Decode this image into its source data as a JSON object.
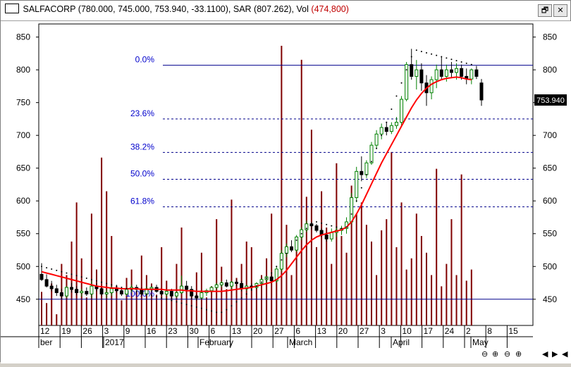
{
  "title": {
    "symbol": "SALFACORP",
    "ohlc": "(780.000, 745.000, 753.940, -33.1100),",
    "sar": "SAR (807.262),",
    "vol_label": "Vol",
    "vol_value": "(474,800)"
  },
  "window_buttons": {
    "restore": "🗗",
    "close": "✕"
  },
  "nav_buttons": [
    "⊖",
    "⊕",
    "⊖",
    "⊕",
    "◀",
    "▶",
    "◀",
    "▶"
  ],
  "colors": {
    "up": "#008000",
    "down": "#000000",
    "ma": "#ff0000",
    "volume": "#800000",
    "fib": "#00008b",
    "sar": "#000000",
    "last_price_bg": "#000000"
  },
  "chart_data": {
    "type": "candlestick",
    "ylim": [
      410,
      870
    ],
    "y_ticks": [
      450,
      500,
      550,
      600,
      650,
      700,
      750,
      800,
      850
    ],
    "last_price_label": "753.940",
    "x_tick_labels": [
      "12",
      "19",
      "26",
      "3",
      "9",
      "16",
      "23",
      "30",
      "6",
      "13",
      "20",
      "27",
      "6",
      "13",
      "20",
      "27",
      "3",
      "10",
      "17",
      "24",
      "2",
      "8",
      "15"
    ],
    "month_labels": [
      "ber",
      "2017",
      "February",
      "March",
      "April",
      "May"
    ],
    "fib_levels": [
      {
        "label": "0.0%",
        "price": 807
      },
      {
        "label": "23.6%",
        "price": 725
      },
      {
        "label": "38.2%",
        "price": 674
      },
      {
        "label": "50.0%",
        "price": 633
      },
      {
        "label": "61.8%",
        "price": 591
      },
      {
        "label": "100.0%",
        "price": 450
      }
    ],
    "candles": [
      {
        "o": 488,
        "h": 505,
        "l": 478,
        "c": 480
      },
      {
        "o": 480,
        "h": 488,
        "l": 468,
        "c": 470
      },
      {
        "o": 470,
        "h": 478,
        "l": 462,
        "c": 466
      },
      {
        "o": 466,
        "h": 472,
        "l": 455,
        "c": 460
      },
      {
        "o": 460,
        "h": 466,
        "l": 450,
        "c": 455
      },
      {
        "o": 455,
        "h": 470,
        "l": 452,
        "c": 468
      },
      {
        "o": 468,
        "h": 475,
        "l": 460,
        "c": 465
      },
      {
        "o": 465,
        "h": 470,
        "l": 456,
        "c": 460
      },
      {
        "o": 460,
        "h": 466,
        "l": 454,
        "c": 462
      },
      {
        "o": 462,
        "h": 468,
        "l": 455,
        "c": 458
      },
      {
        "o": 458,
        "h": 478,
        "l": 452,
        "c": 470
      },
      {
        "o": 470,
        "h": 475,
        "l": 462,
        "c": 466
      },
      {
        "o": 466,
        "h": 470,
        "l": 455,
        "c": 458
      },
      {
        "o": 458,
        "h": 465,
        "l": 452,
        "c": 460
      },
      {
        "o": 460,
        "h": 470,
        "l": 455,
        "c": 466
      },
      {
        "o": 466,
        "h": 472,
        "l": 460,
        "c": 463
      },
      {
        "o": 463,
        "h": 468,
        "l": 455,
        "c": 458
      },
      {
        "o": 458,
        "h": 468,
        "l": 455,
        "c": 465
      },
      {
        "o": 465,
        "h": 472,
        "l": 460,
        "c": 468
      },
      {
        "o": 468,
        "h": 472,
        "l": 460,
        "c": 465
      },
      {
        "o": 465,
        "h": 468,
        "l": 455,
        "c": 458
      },
      {
        "o": 458,
        "h": 470,
        "l": 455,
        "c": 466
      },
      {
        "o": 466,
        "h": 470,
        "l": 462,
        "c": 468
      },
      {
        "o": 468,
        "h": 472,
        "l": 460,
        "c": 462
      },
      {
        "o": 462,
        "h": 465,
        "l": 455,
        "c": 458
      },
      {
        "o": 458,
        "h": 465,
        "l": 454,
        "c": 462
      },
      {
        "o": 462,
        "h": 466,
        "l": 450,
        "c": 455
      },
      {
        "o": 455,
        "h": 462,
        "l": 452,
        "c": 460
      },
      {
        "o": 460,
        "h": 486,
        "l": 458,
        "c": 470
      },
      {
        "o": 470,
        "h": 478,
        "l": 462,
        "c": 465
      },
      {
        "o": 465,
        "h": 470,
        "l": 450,
        "c": 455
      },
      {
        "o": 455,
        "h": 458,
        "l": 448,
        "c": 452
      },
      {
        "o": 452,
        "h": 462,
        "l": 450,
        "c": 460
      },
      {
        "o": 460,
        "h": 466,
        "l": 455,
        "c": 463
      },
      {
        "o": 463,
        "h": 470,
        "l": 460,
        "c": 468
      },
      {
        "o": 468,
        "h": 475,
        "l": 465,
        "c": 472
      },
      {
        "o": 472,
        "h": 478,
        "l": 468,
        "c": 475
      },
      {
        "o": 475,
        "h": 480,
        "l": 468,
        "c": 470
      },
      {
        "o": 470,
        "h": 478,
        "l": 464,
        "c": 476
      },
      {
        "o": 476,
        "h": 480,
        "l": 470,
        "c": 474
      },
      {
        "o": 474,
        "h": 478,
        "l": 462,
        "c": 466
      },
      {
        "o": 466,
        "h": 472,
        "l": 463,
        "c": 470
      },
      {
        "o": 470,
        "h": 474,
        "l": 464,
        "c": 468
      },
      {
        "o": 468,
        "h": 476,
        "l": 466,
        "c": 474
      },
      {
        "o": 474,
        "h": 482,
        "l": 470,
        "c": 480
      },
      {
        "o": 480,
        "h": 486,
        "l": 475,
        "c": 484
      },
      {
        "o": 484,
        "h": 488,
        "l": 476,
        "c": 478
      },
      {
        "o": 478,
        "h": 500,
        "l": 475,
        "c": 496
      },
      {
        "o": 496,
        "h": 525,
        "l": 492,
        "c": 520
      },
      {
        "o": 520,
        "h": 535,
        "l": 514,
        "c": 530
      },
      {
        "o": 530,
        "h": 540,
        "l": 522,
        "c": 525
      },
      {
        "o": 525,
        "h": 548,
        "l": 522,
        "c": 545
      },
      {
        "o": 545,
        "h": 560,
        "l": 540,
        "c": 556
      },
      {
        "o": 556,
        "h": 570,
        "l": 552,
        "c": 565
      },
      {
        "o": 565,
        "h": 568,
        "l": 556,
        "c": 562
      },
      {
        "o": 562,
        "h": 565,
        "l": 552,
        "c": 555
      },
      {
        "o": 555,
        "h": 558,
        "l": 545,
        "c": 548
      },
      {
        "o": 548,
        "h": 552,
        "l": 538,
        "c": 542
      },
      {
        "o": 542,
        "h": 558,
        "l": 538,
        "c": 552
      },
      {
        "o": 552,
        "h": 560,
        "l": 545,
        "c": 555
      },
      {
        "o": 555,
        "h": 562,
        "l": 548,
        "c": 558
      },
      {
        "o": 558,
        "h": 575,
        "l": 550,
        "c": 568
      },
      {
        "o": 568,
        "h": 612,
        "l": 565,
        "c": 605
      },
      {
        "o": 605,
        "h": 652,
        "l": 598,
        "c": 645
      },
      {
        "o": 645,
        "h": 668,
        "l": 630,
        "c": 640
      },
      {
        "o": 640,
        "h": 662,
        "l": 635,
        "c": 658
      },
      {
        "o": 658,
        "h": 690,
        "l": 655,
        "c": 685
      },
      {
        "o": 685,
        "h": 708,
        "l": 680,
        "c": 702
      },
      {
        "o": 702,
        "h": 718,
        "l": 694,
        "c": 712
      },
      {
        "o": 712,
        "h": 720,
        "l": 700,
        "c": 706
      },
      {
        "o": 706,
        "h": 720,
        "l": 702,
        "c": 715
      },
      {
        "o": 715,
        "h": 728,
        "l": 710,
        "c": 720
      },
      {
        "o": 720,
        "h": 760,
        "l": 715,
        "c": 755
      },
      {
        "o": 755,
        "h": 812,
        "l": 752,
        "c": 808
      },
      {
        "o": 808,
        "h": 832,
        "l": 785,
        "c": 790
      },
      {
        "o": 790,
        "h": 815,
        "l": 770,
        "c": 800
      },
      {
        "o": 800,
        "h": 810,
        "l": 768,
        "c": 780
      },
      {
        "o": 780,
        "h": 792,
        "l": 745,
        "c": 765
      },
      {
        "o": 765,
        "h": 790,
        "l": 755,
        "c": 785
      },
      {
        "o": 785,
        "h": 808,
        "l": 772,
        "c": 800
      },
      {
        "o": 800,
        "h": 820,
        "l": 785,
        "c": 790
      },
      {
        "o": 790,
        "h": 808,
        "l": 782,
        "c": 800
      },
      {
        "o": 800,
        "h": 812,
        "l": 788,
        "c": 796
      },
      {
        "o": 796,
        "h": 810,
        "l": 785,
        "c": 802
      },
      {
        "o": 802,
        "h": 808,
        "l": 785,
        "c": 790
      },
      {
        "o": 790,
        "h": 802,
        "l": 778,
        "c": 786
      },
      {
        "o": 786,
        "h": 802,
        "l": 778,
        "c": 800
      },
      {
        "o": 800,
        "h": 806,
        "l": 786,
        "c": 790
      },
      {
        "o": 780,
        "h": 786,
        "l": 745,
        "c": 754
      }
    ],
    "moving_average": [
      492,
      490,
      488,
      486,
      484,
      482,
      480,
      478,
      476,
      474,
      472,
      470,
      469,
      468,
      467,
      467,
      466,
      466,
      466,
      466,
      465,
      465,
      465,
      465,
      465,
      464,
      464,
      464,
      464,
      463,
      463,
      462,
      462,
      462,
      462,
      462,
      462,
      463,
      464,
      465,
      466,
      467,
      468,
      470,
      472,
      474,
      476,
      480,
      486,
      494,
      504,
      514,
      524,
      533,
      540,
      545,
      548,
      550,
      552,
      554,
      556,
      560,
      568,
      580,
      594,
      610,
      626,
      642,
      658,
      672,
      686,
      700,
      714,
      728,
      742,
      754,
      764,
      772,
      778,
      782,
      785,
      787,
      788,
      789,
      788,
      786,
      785
    ],
    "sar": [
      500,
      498,
      496,
      494,
      492,
      490,
      488,
      486,
      484,
      482,
      480,
      478,
      476,
      474,
      472,
      470,
      468,
      466,
      464,
      462,
      460,
      458,
      456,
      454,
      452,
      450,
      448,
      446,
      444,
      442,
      440,
      438,
      436,
      434,
      432,
      430,
      430,
      434,
      440,
      446,
      452,
      458,
      464,
      470,
      476,
      482,
      490,
      500,
      510,
      520,
      530,
      540,
      550,
      558,
      565,
      568,
      566,
      564,
      562,
      560,
      558,
      560,
      580,
      600,
      620,
      640,
      660,
      680,
      700,
      720,
      740,
      760,
      780,
      800,
      820,
      830,
      828,
      826,
      824,
      822,
      820,
      818,
      816,
      814,
      812,
      810,
      808
    ],
    "volume": [
      12,
      8,
      15,
      4,
      22,
      18,
      30,
      44,
      24,
      10,
      40,
      20,
      60,
      48,
      32,
      14,
      9,
      17,
      20,
      12,
      25,
      18,
      15,
      11,
      28,
      16,
      12,
      22,
      35,
      14,
      11,
      19,
      26,
      10,
      14,
      38,
      21,
      13,
      45,
      17,
      22,
      30,
      28,
      15,
      18,
      24,
      40,
      20,
      100,
      36,
      18,
      30,
      95,
      46,
      70,
      28,
      48,
      35,
      22,
      58,
      32,
      26,
      50,
      40,
      44,
      36,
      30,
      18,
      34,
      38,
      62,
      28,
      44,
      20,
      24,
      40,
      32,
      26,
      18,
      56,
      14,
      22,
      38,
      18,
      54,
      16,
      20
    ]
  }
}
